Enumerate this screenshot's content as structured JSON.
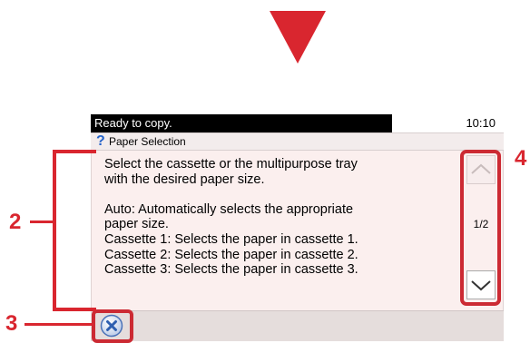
{
  "status": {
    "message": "Ready to copy.",
    "time": "10:10"
  },
  "dialog": {
    "title": "Paper Selection",
    "help_icon": "question-mark-icon",
    "message": "Select the cassette or the multipurpose tray\nwith the desired paper size.\n\nAuto: Automatically selects the appropriate\npaper size.\nCassette 1: Selects the paper in cassette 1.\nCassette 2: Selects the paper in cassette 2.\nCassette 3: Selects the paper in cassette 3."
  },
  "scroll": {
    "page_indicator": "1/2",
    "up_icon": "chevron-up-icon",
    "down_icon": "chevron-down-icon"
  },
  "close": {
    "icon": "close-x-icon"
  },
  "callouts": {
    "label_2": "2",
    "label_3": "3",
    "label_4": "4"
  },
  "colors": {
    "accent_red": "#d9262f",
    "status_bar": "#000000",
    "panel_background": "#fbefee",
    "help_icon": "#2563c9",
    "close_icon": "#2e5fb0"
  }
}
